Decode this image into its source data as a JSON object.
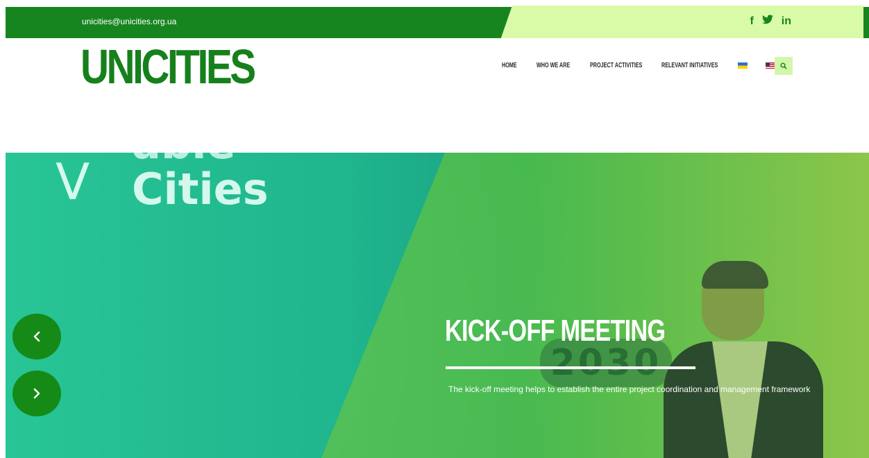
{
  "topbar": {
    "email": "unicities@unicities.org.ua",
    "social": [
      {
        "label": "f",
        "icon": "facebook-icon"
      },
      {
        "label": "𝕪",
        "icon": "twitter-icon"
      },
      {
        "label": "in",
        "icon": "linkedin-icon"
      }
    ]
  },
  "header": {
    "logo": "UNICITIES",
    "nav": {
      "home": "HOME",
      "who": "WHO WE ARE",
      "project": "PROJECT ACTIVITIES",
      "initiatives": "RELEVANT INITIATIVES"
    },
    "languages": [
      "ukrainian-flag",
      "us-flag"
    ],
    "search_icon": "search-icon"
  },
  "hero": {
    "background_text": {
      "top": "able",
      "v": "V",
      "cities": "Cities"
    },
    "badge": "2030",
    "title": "KICK-OFF MEETING",
    "description": "The kick-off meeting helps to establish the entire project coordination and management framework",
    "prev_icon": "chevron-left-icon",
    "next_icon": "chevron-right-icon"
  },
  "colors": {
    "brand_green": "#17851f",
    "light_green": "#d9fba8",
    "arrow_green": "#168a17"
  }
}
